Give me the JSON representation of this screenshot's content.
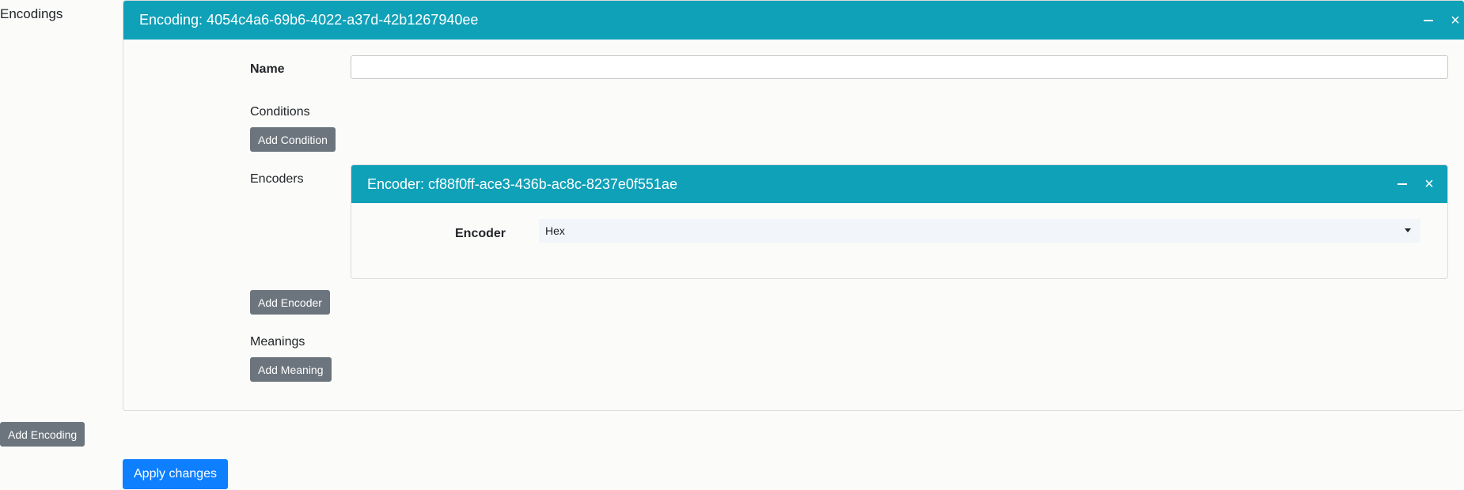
{
  "sidebar": {
    "encodings_label": "Encodings",
    "add_encoding_label": "Add Encoding"
  },
  "encoding": {
    "title": "Encoding: 4054c4a6-69b6-4022-a37d-42b1267940ee",
    "name_label": "Name",
    "name_value": "",
    "conditions_label": "Conditions",
    "add_condition_label": "Add Condition",
    "encoders_label": "Encoders",
    "add_encoder_label": "Add Encoder",
    "meanings_label": "Meanings",
    "add_meaning_label": "Add Meaning",
    "minimize_icon": "minus-icon",
    "close_icon": "close-icon"
  },
  "encoder": {
    "title": "Encoder: cf88f0ff-ace3-436b-ac8c-8237e0f551ae",
    "field_label": "Encoder",
    "selected_value": "Hex",
    "minimize_icon": "minus-icon",
    "close_icon": "close-icon"
  },
  "footer": {
    "apply_label": "Apply changes"
  },
  "colors": {
    "header_teal": "#0fa1b8",
    "button_gray": "#6c757d",
    "button_primary": "#0d7fff"
  }
}
